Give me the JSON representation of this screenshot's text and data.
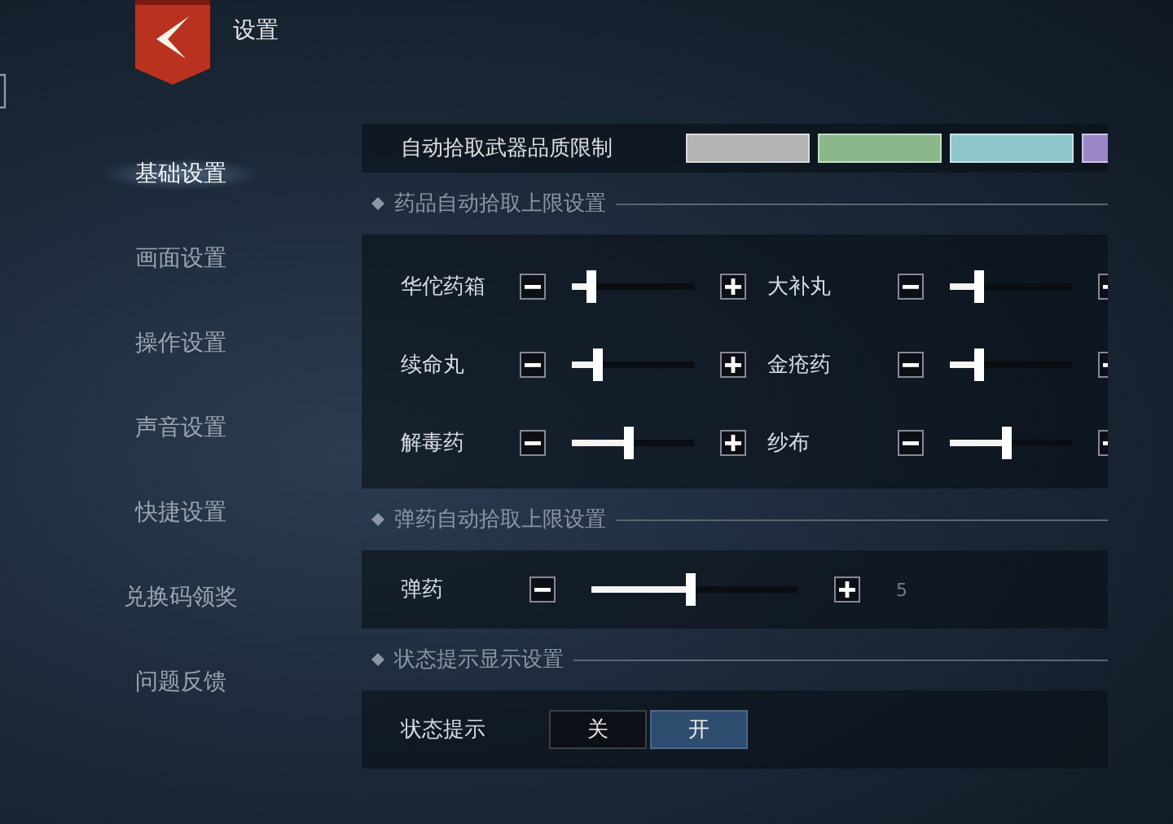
{
  "header": {
    "title": "设置"
  },
  "sidebar": {
    "items": [
      {
        "label": "基础设置",
        "selected": true
      },
      {
        "label": "画面设置",
        "selected": false
      },
      {
        "label": "操作设置",
        "selected": false
      },
      {
        "label": "声音设置",
        "selected": false
      },
      {
        "label": "快捷设置",
        "selected": false
      },
      {
        "label": "兑换码领奖",
        "selected": false
      },
      {
        "label": "问题反馈",
        "selected": false
      }
    ]
  },
  "weapon_quality": {
    "label": "自动拾取武器品质限制",
    "swatches": [
      {
        "color": "#b4b4b4"
      },
      {
        "color": "#8ab88a"
      },
      {
        "color": "#8ec6cc"
      },
      {
        "color": "#9a88c8"
      }
    ]
  },
  "medicine": {
    "heading": "药品自动拾取上限设置",
    "items": [
      {
        "label": "华佗药箱",
        "level": 0.2
      },
      {
        "label": "大补丸",
        "level": 0.28
      },
      {
        "label": "续命丸",
        "level": 0.25
      },
      {
        "label": "金疮药",
        "level": 0.28
      },
      {
        "label": "解毒药",
        "level": 0.5
      },
      {
        "label": "纱布",
        "level": 0.5
      }
    ]
  },
  "ammo": {
    "heading": "弹药自动拾取上限设置",
    "items": [
      {
        "label": "弹药",
        "level": 0.5,
        "reading": "5"
      }
    ]
  },
  "status": {
    "heading": "状态提示显示设置",
    "label": "状态提示",
    "options": [
      {
        "label": "关",
        "selected": false
      },
      {
        "label": "开",
        "selected": true
      }
    ]
  }
}
